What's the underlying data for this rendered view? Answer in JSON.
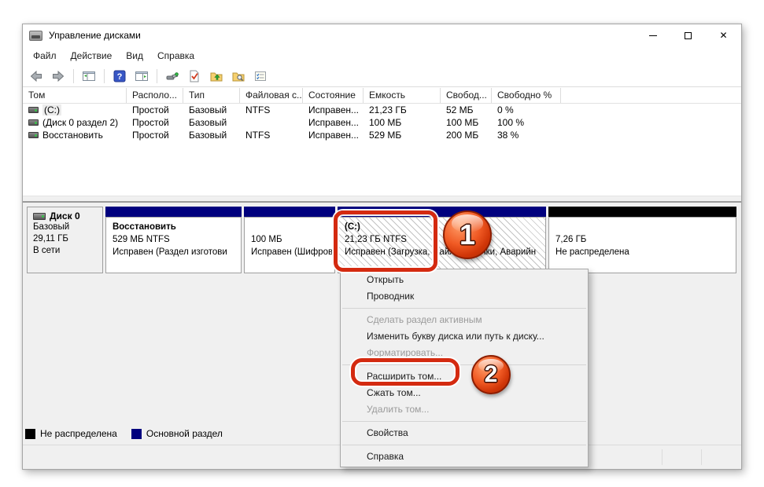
{
  "window": {
    "title": "Управление дисками",
    "controls": {
      "minimize": "",
      "maximize": "",
      "close": "✕"
    }
  },
  "menu_bar": [
    "Файл",
    "Действие",
    "Вид",
    "Справка"
  ],
  "toolbar": {
    "icons": [
      "back-arrow",
      "forward-arrow",
      "console-tree",
      "help",
      "action-pane",
      "remote-tool",
      "check-document",
      "folder-up",
      "folder-search",
      "task-list"
    ],
    "help_glyph": "?"
  },
  "volume_list": {
    "columns": [
      "Том",
      "Располо...",
      "Тип",
      "Файловая с...",
      "Состояние",
      "Емкость",
      "Свобод...",
      "Свободно %"
    ],
    "rows": [
      {
        "volume": "(C:)",
        "location": "Простой",
        "type": "Базовый",
        "fs": "NTFS",
        "status": "Исправен...",
        "capacity": "21,23 ГБ",
        "free": "52 МБ",
        "free_pct": "0 %"
      },
      {
        "volume": "(Диск 0 раздел 2)",
        "location": "Простой",
        "type": "Базовый",
        "fs": "",
        "status": "Исправен...",
        "capacity": "100 МБ",
        "free": "100 МБ",
        "free_pct": "100 %"
      },
      {
        "volume": "Восстановить",
        "location": "Простой",
        "type": "Базовый",
        "fs": "NTFS",
        "status": "Исправен...",
        "capacity": "529 МБ",
        "free": "200 МБ",
        "free_pct": "38 %"
      }
    ]
  },
  "disk": {
    "name": "Диск 0",
    "type": "Базовый",
    "size": "29,11 ГБ",
    "status": "В сети",
    "partitions": [
      {
        "title": "Восстановить",
        "size_line": "529 МБ NTFS",
        "status_line": "Исправен (Раздел изготови",
        "kind": "primary"
      },
      {
        "title": "",
        "size_line": "100 МБ",
        "status_line": "Исправен (Шифров",
        "kind": "primary"
      },
      {
        "title": "(C:)",
        "size_line": "21,23 ГБ NTFS",
        "status_line": "Исправен (Загрузка, Файл подкачки, Аварийн",
        "kind": "primary-selected"
      },
      {
        "title": "",
        "size_line": "7,26 ГБ",
        "status_line": "Не распределена",
        "kind": "unallocated"
      }
    ]
  },
  "legend": [
    {
      "label": "Не распределена",
      "color": "#000000"
    },
    {
      "label": "Основной раздел",
      "color": "#00007e"
    }
  ],
  "context_menu": {
    "items": [
      {
        "label": "Открыть"
      },
      {
        "label": "Проводник"
      },
      {
        "label": "Сделать раздел активным",
        "disabled": true
      },
      {
        "label": "Изменить букву диска или путь к диску..."
      },
      {
        "label": "Форматировать...",
        "disabled": true
      },
      {
        "label": "Расширить том...",
        "highlighted": true
      },
      {
        "label": "Сжать том..."
      },
      {
        "label": "Удалить том...",
        "disabled": true
      },
      {
        "label": "Свойства"
      },
      {
        "label": "Справка"
      }
    ]
  },
  "annotations": {
    "step1": "1",
    "step2": "2",
    "accent_color": "#d42a10"
  }
}
